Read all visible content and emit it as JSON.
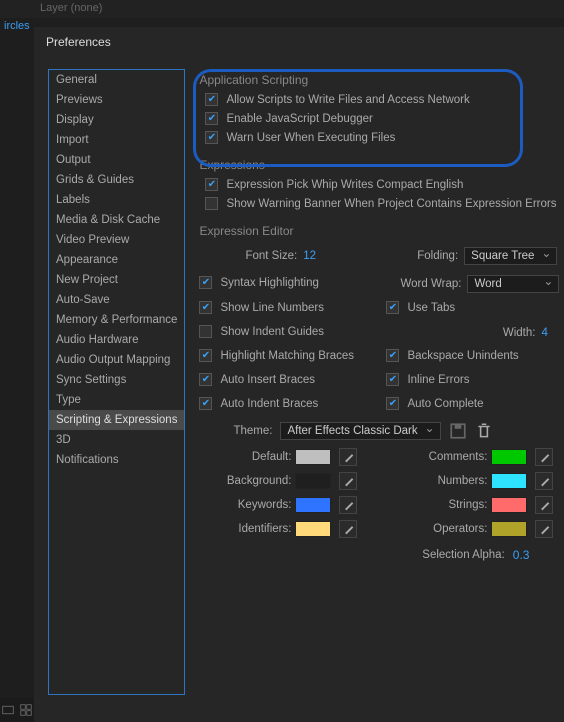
{
  "bg": {
    "layer_label": "Layer  (none)",
    "tab": "ircles"
  },
  "window": {
    "title": "Preferences"
  },
  "categories": [
    "General",
    "Previews",
    "Display",
    "Import",
    "Output",
    "Grids & Guides",
    "Labels",
    "Media & Disk Cache",
    "Video Preview",
    "Appearance",
    "New Project",
    "Auto-Save",
    "Memory & Performance",
    "Audio Hardware",
    "Audio Output Mapping",
    "Sync Settings",
    "Type",
    "Scripting & Expressions",
    "3D",
    "Notifications"
  ],
  "selected_category_index": 17,
  "app_scripting": {
    "title": "Application Scripting",
    "allow_write": {
      "label": "Allow Scripts to Write Files and Access Network",
      "checked": true
    },
    "enable_debugger": {
      "label": "Enable JavaScript Debugger",
      "checked": true
    },
    "warn_exec": {
      "label": "Warn User When Executing Files",
      "checked": true
    }
  },
  "expressions": {
    "title": "Expressions",
    "pick_whip": {
      "label": "Expression Pick Whip Writes Compact English",
      "checked": true
    },
    "banner": {
      "label": "Show Warning Banner When Project Contains Expression Errors",
      "checked": false
    }
  },
  "editor": {
    "title": "Expression Editor",
    "font_size": {
      "label": "Font Size:",
      "value": "12"
    },
    "folding": {
      "label": "Folding:",
      "value": "Square Tree"
    },
    "word_wrap": {
      "label": "Word Wrap:",
      "value": "Word"
    },
    "syntax": {
      "label": "Syntax Highlighting",
      "checked": true
    },
    "line_numbers": {
      "label": "Show Line Numbers",
      "checked": true
    },
    "indent_guides": {
      "label": "Show Indent Guides",
      "checked": false
    },
    "match_braces": {
      "label": "Highlight Matching Braces",
      "checked": true
    },
    "auto_insert": {
      "label": "Auto Insert Braces",
      "checked": true
    },
    "auto_indent": {
      "label": "Auto Indent Braces",
      "checked": true
    },
    "use_tabs": {
      "label": "Use Tabs",
      "checked": true
    },
    "width": {
      "label": "Width:",
      "value": "4"
    },
    "backspace": {
      "label": "Backspace Unindents",
      "checked": true
    },
    "inline_errors": {
      "label": "Inline Errors",
      "checked": true
    },
    "auto_complete": {
      "label": "Auto Complete",
      "checked": true
    }
  },
  "theme": {
    "label": "Theme:",
    "value": "After Effects Classic Dark",
    "colors": {
      "default": {
        "label": "Default:",
        "hex": "#bfbfbf"
      },
      "comments": {
        "label": "Comments:",
        "hex": "#00c800"
      },
      "background": {
        "label": "Background:",
        "hex": "#1f1f1f"
      },
      "numbers": {
        "label": "Numbers:",
        "hex": "#2ee3ff"
      },
      "keywords": {
        "label": "Keywords:",
        "hex": "#2f74ff"
      },
      "strings": {
        "label": "Strings:",
        "hex": "#ff6b6b"
      },
      "identifiers": {
        "label": "Identifiers:",
        "hex": "#ffd97a"
      },
      "operators": {
        "label": "Operators:",
        "hex": "#b0a32a"
      }
    },
    "selection_alpha": {
      "label": "Selection Alpha:",
      "value": "0.3"
    }
  }
}
